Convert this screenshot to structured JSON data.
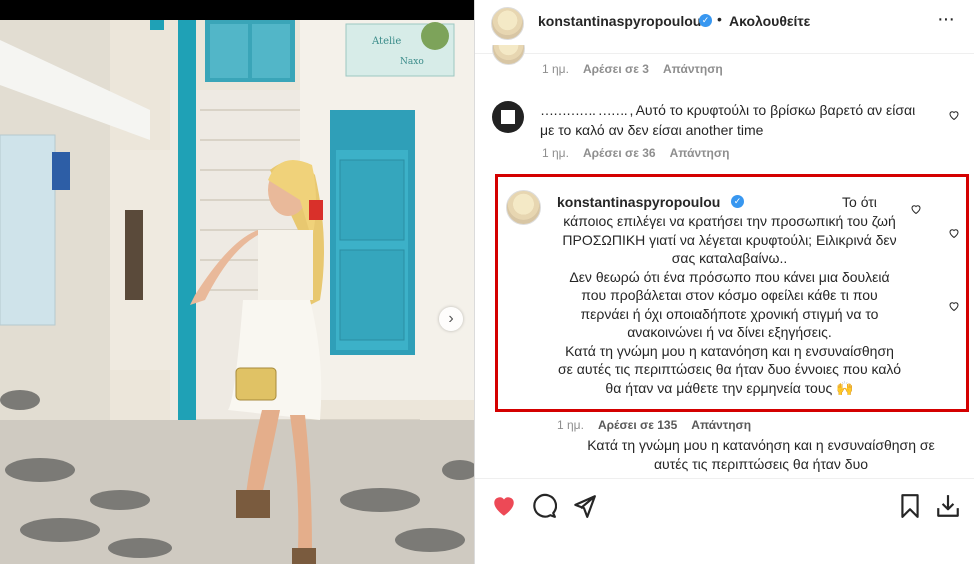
{
  "post": {
    "username": "konstantinaspyropoulou",
    "separator": "•",
    "follow_label": "Ακολουθείτε",
    "more_label": "···",
    "next_label": "›"
  },
  "photo_sign": {
    "line1": "Atelie",
    "line2": "Naxo"
  },
  "comments": [
    {
      "time": "1 ημ.",
      "likes": "Αρέσει σε 3",
      "reply": "Απάντηση"
    },
    {
      "username": "…………. ……. ,",
      "text": "Αυτό το κρυφτούλι το βρίσκω βαρετό αν είσαι με το καλό αν δεν είσαι another time",
      "time": "1 ημ.",
      "likes": "Αρέσει σε 36",
      "reply": "Απάντηση"
    },
    {
      "username": "konstantinaspyropoulou",
      "first": "Το ότι",
      "body": "κάποιος επιλέγει να κρατήσει την προσωπική του ζωή ΠΡΟΣΩΠΙΚΗ γιατί να λέγεται κρυφτούλι; Ειλικρινά δεν σας καταλαβαίνω..\nΔεν θεωρώ ότι ένα πρόσωπο που κάνει μια δουλειά που προβάλεται στον κόσμο οφείλει κάθε τι που περνάει ή όχι οποιαδήποτε χρονική στιγμή να το ανακοινώνει ή να δίνει εξηγήσεις.\nΚατά τη γνώμη μου η κατανόηση και η ενσυναίσθηση σε αυτές τις περιπτώσεις θα ήταν δυο έννοιες που καλό θα ήταν να μάθετε την ερμηνεία τους 🙌",
      "time": "1 ημ.",
      "likes": "Αρέσει σε 135",
      "reply": "Απάντηση"
    },
    {
      "text": "Κατά τη γνώμη μου η κατανόηση και η ενσυναίσθηση σε αυτές τις περιπτώσεις θα ήταν δυο"
    }
  ],
  "colors": {
    "like_active": "#ed4956",
    "highlight_border": "#d40000",
    "verified": "#3897f0"
  },
  "icons": [
    "heart-icon",
    "comment-icon",
    "share-icon",
    "bookmark-icon",
    "download-icon"
  ]
}
